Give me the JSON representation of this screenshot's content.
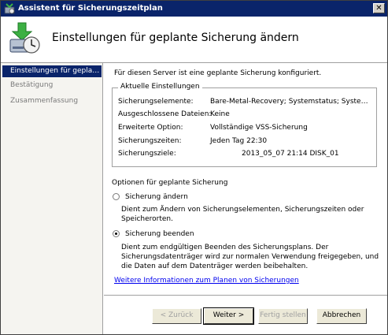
{
  "window": {
    "title": "Assistent für Sicherungszeitplan",
    "close_label": "✕"
  },
  "header": {
    "title": "Einstellungen für geplante Sicherung ändern"
  },
  "sidebar": {
    "items": [
      {
        "label": "Einstellungen für gepla…"
      },
      {
        "label": "Bestätigung"
      },
      {
        "label": "Zusammenfassung"
      }
    ]
  },
  "main": {
    "intro": "Für diesen Server ist eine geplante Sicherung konfiguriert.",
    "current": {
      "legend": "Aktuelle Einstellungen",
      "rows": [
        {
          "label": "Sicherungselemente:",
          "value": "Bare-Metal-Recovery; Systemstatus; Syste…"
        },
        {
          "label": "Ausgeschlossene Dateien:",
          "value": "Keine"
        },
        {
          "label": "Erweiterte Option:",
          "value": "Vollständige VSS-Sicherung"
        },
        {
          "label": "Sicherungszeiten:",
          "value": "Jeden Tag 22:30"
        },
        {
          "label": "Sicherungsziele:",
          "value": "2013_05_07 21:14 DISK_01"
        }
      ]
    },
    "options_label": "Optionen für geplante Sicherung",
    "option_change": {
      "label": "Sicherung ändern",
      "selected": false,
      "description": "Dient zum Ändern von Sicherungselementen, Sicherungszeiten oder Speicherorten."
    },
    "option_stop": {
      "label": "Sicherung beenden",
      "selected": true,
      "description": "Dient zum endgültigen Beenden des Sicherungsplans. Der Sicherungsdatenträger wird zur normalen Verwendung freigegeben, und die Daten auf dem Datenträger werden beibehalten."
    },
    "more_info_link": "Weitere Informationen zum Planen von Sicherungen"
  },
  "buttons": {
    "back": "< Zurück",
    "next": "Weiter >",
    "finish": "Fertig stellen",
    "cancel": "Abbrechen"
  }
}
